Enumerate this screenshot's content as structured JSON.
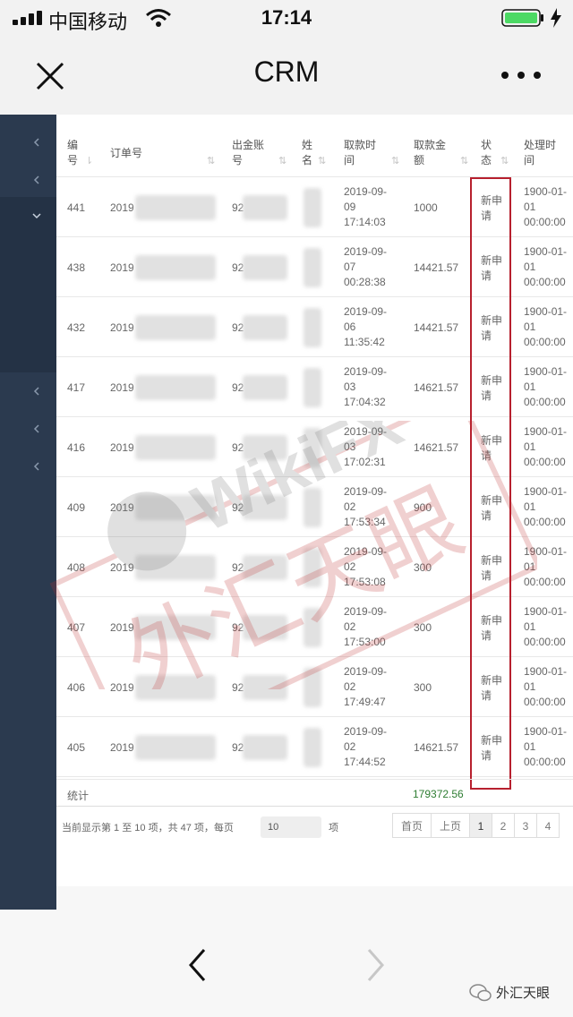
{
  "status": {
    "carrier": "中国移动",
    "time": "17:14"
  },
  "nav": {
    "title": "CRM"
  },
  "table": {
    "headers": {
      "id": [
        "编",
        "号"
      ],
      "order": [
        "订单号"
      ],
      "account": [
        "出金账",
        "号"
      ],
      "name": [
        "姓",
        "名"
      ],
      "time": [
        "取款时",
        "间"
      ],
      "amount": [
        "取款金",
        "额"
      ],
      "status": [
        "状",
        "态"
      ],
      "process": [
        "处理时",
        "间"
      ]
    },
    "rows": [
      {
        "id": "441",
        "order": "2019",
        "account": "92",
        "time": [
          "2019-09-",
          "09",
          "17:14:03"
        ],
        "amount": "1000",
        "status": [
          "新申",
          "请"
        ],
        "process": [
          "1900-01-",
          "01",
          "00:00:00"
        ]
      },
      {
        "id": "438",
        "order": "2019",
        "account": "92",
        "time": [
          "2019-09-",
          "07",
          "00:28:38"
        ],
        "amount": "14421.57",
        "status": [
          "新申",
          "请"
        ],
        "process": [
          "1900-01-",
          "01",
          "00:00:00"
        ]
      },
      {
        "id": "432",
        "order": "2019",
        "account": "92",
        "time": [
          "2019-09-",
          "06",
          "11:35:42"
        ],
        "amount": "14421.57",
        "status": [
          "新申",
          "请"
        ],
        "process": [
          "1900-01-",
          "01",
          "00:00:00"
        ]
      },
      {
        "id": "417",
        "order": "2019",
        "account": "92",
        "time": [
          "2019-09-",
          "03",
          "17:04:32"
        ],
        "amount": "14621.57",
        "status": [
          "新申",
          "请"
        ],
        "process": [
          "1900-01-",
          "01",
          "00:00:00"
        ]
      },
      {
        "id": "416",
        "order": "2019",
        "account": "92",
        "time": [
          "2019-09-",
          "03",
          "17:02:31"
        ],
        "amount": "14621.57",
        "status": [
          "新申",
          "请"
        ],
        "process": [
          "1900-01-",
          "01",
          "00:00:00"
        ]
      },
      {
        "id": "409",
        "order": "2019",
        "account": "92",
        "time": [
          "2019-09-",
          "02",
          "17:53:34"
        ],
        "amount": "900",
        "status": [
          "新申",
          "请"
        ],
        "process": [
          "1900-01-",
          "01",
          "00:00:00"
        ]
      },
      {
        "id": "408",
        "order": "2019",
        "account": "92",
        "time": [
          "2019-09-",
          "02",
          "17:53:08"
        ],
        "amount": "300",
        "status": [
          "新申",
          "请"
        ],
        "process": [
          "1900-01-",
          "01",
          "00:00:00"
        ]
      },
      {
        "id": "407",
        "order": "2019",
        "account": "92",
        "time": [
          "2019-09-",
          "02",
          "17:53:00"
        ],
        "amount": "300",
        "status": [
          "新申",
          "请"
        ],
        "process": [
          "1900-01-",
          "01",
          "00:00:00"
        ]
      },
      {
        "id": "406",
        "order": "2019",
        "account": "92",
        "time": [
          "2019-09-",
          "02",
          "17:49:47"
        ],
        "amount": "300",
        "status": [
          "新申",
          "请"
        ],
        "process": [
          "1900-01-",
          "01",
          "00:00:00"
        ]
      },
      {
        "id": "405",
        "order": "2019",
        "account": "92",
        "time": [
          "2019-09-",
          "02",
          "17:44:52"
        ],
        "amount": "14621.57",
        "status": [
          "新申",
          "请"
        ],
        "process": [
          "1900-01-",
          "01",
          "00:00:00"
        ]
      }
    ],
    "summary": {
      "label": "统计",
      "total": "179372.56"
    }
  },
  "pager": {
    "info": "当前显示第 1 至 10 项，共 47 项，每页",
    "page_size": "10",
    "unit": "项",
    "first": "首页",
    "prev": "上页",
    "pages": [
      "1",
      "2",
      "3",
      "4"
    ]
  },
  "watermark": {
    "brand": "WikiFX",
    "cn": "外汇天眼"
  },
  "footer": {
    "brand": "外汇天眼"
  },
  "colors": {
    "sidebar": "#2b3a4f",
    "highlight": "#b7202e",
    "total": "#2e7d32"
  }
}
